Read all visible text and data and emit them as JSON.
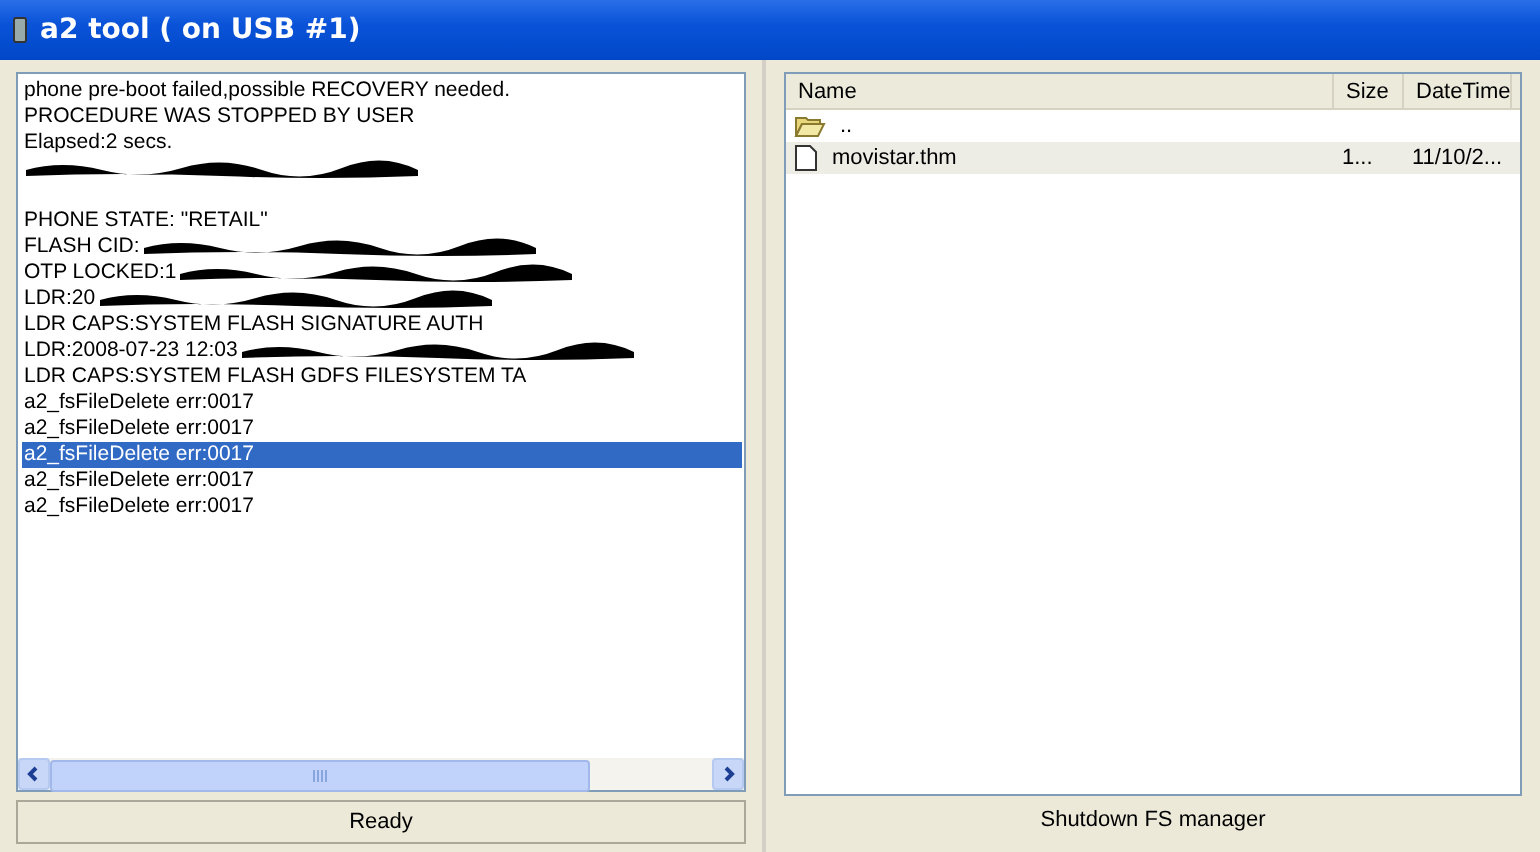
{
  "window": {
    "title": "a2 tool ( on USB #1)"
  },
  "log": {
    "lines": [
      {
        "text": "phone pre-boot failed,possible RECOVERY needed.",
        "redacted": false,
        "selected": false
      },
      {
        "text": "PROCEDURE WAS STOPPED BY USER",
        "redacted": false,
        "selected": false
      },
      {
        "text": "Elapsed:2 secs.",
        "redacted": false,
        "selected": false
      },
      {
        "redacted": true,
        "selected": false
      },
      {
        "redacted": false,
        "selected": false
      },
      {
        "text": "PHONE STATE: \"RETAIL\"",
        "redacted": false,
        "selected": false
      },
      {
        "text": "FLASH CID:",
        "redacted": true,
        "selected": false
      },
      {
        "text": "OTP LOCKED:1",
        "redacted": true,
        "selected": false
      },
      {
        "text": "LDR:20",
        "redacted": true,
        "selected": false
      },
      {
        "text": "LDR CAPS:SYSTEM FLASH SIGNATURE AUTH",
        "redacted": false,
        "selected": false
      },
      {
        "text": "LDR:2008-07-23 12:03",
        "redacted": true,
        "selected": false
      },
      {
        "text": "LDR CAPS:SYSTEM FLASH GDFS FILESYSTEM TA",
        "redacted": false,
        "selected": false
      },
      {
        "text": "a2_fsFileDelete err:0017",
        "redacted": false,
        "selected": false
      },
      {
        "text": "a2_fsFileDelete err:0017",
        "redacted": false,
        "selected": false
      },
      {
        "text": "a2_fsFileDelete err:0017",
        "redacted": false,
        "selected": true
      },
      {
        "text": "a2_fsFileDelete err:0017",
        "redacted": false,
        "selected": false
      },
      {
        "text": "a2_fsFileDelete err:0017",
        "redacted": false,
        "selected": false
      }
    ]
  },
  "status": "Ready",
  "files": {
    "columns": [
      "Name",
      "Size",
      "DateTime"
    ],
    "rows": [
      {
        "kind": "folder",
        "name": ".."
      },
      {
        "kind": "file",
        "name": "movistar.thm",
        "size": "1...",
        "date": "11/10/2..."
      }
    ]
  },
  "shutdown_button": "Shutdown FS manager"
}
